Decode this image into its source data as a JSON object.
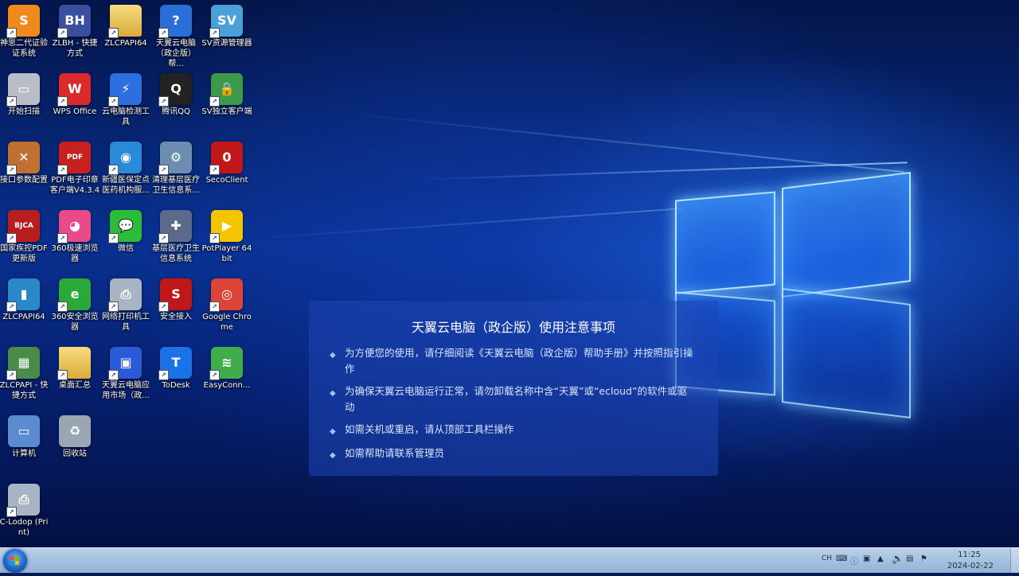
{
  "desktop": {
    "icons": [
      {
        "label": "神思二代证验证系统",
        "icon": "shensi-app-icon"
      },
      {
        "label": "ZLBH - 快捷方式",
        "icon": "zlbh-logo-icon"
      },
      {
        "label": "ZLCPAPI64",
        "icon": "folder-icon"
      },
      {
        "label": "天翼云电脑（政企版）帮...",
        "icon": "help-doc-icon"
      },
      {
        "label": "SV资源管理器",
        "icon": "sv-manager-icon"
      },
      {
        "label": "开始扫描",
        "icon": "scanner-icon"
      },
      {
        "label": "WPS Office",
        "icon": "wps-icon"
      },
      {
        "label": "云电脑检测工具",
        "icon": "cloud-check-icon"
      },
      {
        "label": "腾讯QQ",
        "icon": "qq-penguin-icon"
      },
      {
        "label": "SV独立客户端",
        "icon": "shield-lock-icon"
      },
      {
        "label": "接口参数配置",
        "icon": "tools-icon"
      },
      {
        "label": "PDF电子印章客户端V4.3.4",
        "icon": "pdf-icon"
      },
      {
        "label": "新疆医保定点医药机构服...",
        "icon": "medical-insurance-icon"
      },
      {
        "label": "清理基层医疗卫生信息系...",
        "icon": "cleanup-icon"
      },
      {
        "label": "SecoClient",
        "icon": "secoclient-icon"
      },
      {
        "label": "国家疾控PDF更新版",
        "icon": "bjca-icon"
      },
      {
        "label": "360极速浏览器",
        "icon": "browser-360-speed-icon"
      },
      {
        "label": "微信",
        "icon": "wechat-icon"
      },
      {
        "label": "基层医疗卫生信息系统",
        "icon": "medical-system-icon"
      },
      {
        "label": "PotPlayer 64 bit",
        "icon": "potplayer-icon"
      },
      {
        "label": "ZLCPAPI64",
        "icon": "archive-icon"
      },
      {
        "label": "360安全浏览器",
        "icon": "browser-360-safe-icon"
      },
      {
        "label": "网络打印机工具",
        "icon": "printer-icon"
      },
      {
        "label": "安全接入",
        "icon": "secure-access-icon"
      },
      {
        "label": "Google Chrome",
        "icon": "chrome-icon"
      },
      {
        "label": "ZLCPAPI - 快捷方式",
        "icon": "window-app-icon"
      },
      {
        "label": "桌面汇总",
        "icon": "folder-icon"
      },
      {
        "label": "天翼云电脑应用市场（政...",
        "icon": "app-market-icon"
      },
      {
        "label": "ToDesk",
        "icon": "todesk-icon"
      },
      {
        "label": "EasyConn...",
        "icon": "easyconnect-icon"
      },
      {
        "label": "计算机",
        "icon": "computer-icon"
      },
      {
        "label": "回收站",
        "icon": "recycle-bin-icon"
      },
      {
        "label": "C-Lodop (Print)",
        "icon": "printer-icon"
      }
    ]
  },
  "notice": {
    "title": "天翼云电脑（政企版）使用注意事项",
    "items": [
      "为方便您的使用，请仔细阅读《天翼云电脑（政企版）帮助手册》并按照指引操作",
      "为确保天翼云电脑运行正常，请勿卸载名称中含“天翼”或“ecloud”的软件或驱动",
      "如需关机或重启，请从顶部工具栏操作",
      "如需帮助请联系管理员"
    ]
  },
  "taskbar": {
    "time": "11:25",
    "date": "2024-02-22",
    "tray": {
      "input_method": "CH"
    }
  },
  "colors": {
    "wallpaper_dark": "#04154a",
    "wallpaper_glow": "#2878ff",
    "taskbar": "#a6c1df"
  }
}
